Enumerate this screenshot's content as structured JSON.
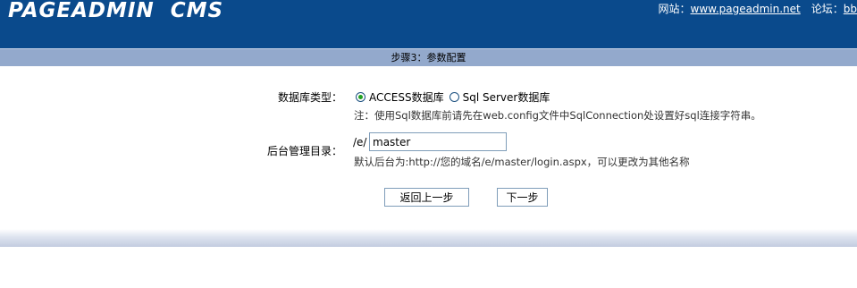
{
  "header": {
    "logo": "PAGEADMIN  CMS",
    "site_label": "网站：",
    "site_link": "www.pageadmin.net",
    "forum_label": "论坛：",
    "forum_link": "bb"
  },
  "step_title": "步骤3：参数配置",
  "form": {
    "db_type_label": "数据库类型：",
    "db_options": [
      {
        "label": "ACCESS数据库",
        "checked": true
      },
      {
        "label": "Sql Server数据库",
        "checked": false
      }
    ],
    "db_note": "注：使用Sql数据库前请先在web.config文件中SqlConnection处设置好sql连接字符串。",
    "admin_dir_label": "后台管理目录：",
    "admin_dir_prefix": "/e/",
    "admin_dir_value": "master",
    "admin_dir_note": "默认后台为:http://您的域名/e/master/login.aspx，可以更改为其他名称"
  },
  "buttons": {
    "back": "返回上一步",
    "next": "下一步"
  },
  "colors": {
    "header_bg": "#0a4a8c",
    "step_bar_bg": "#93a9cc"
  }
}
